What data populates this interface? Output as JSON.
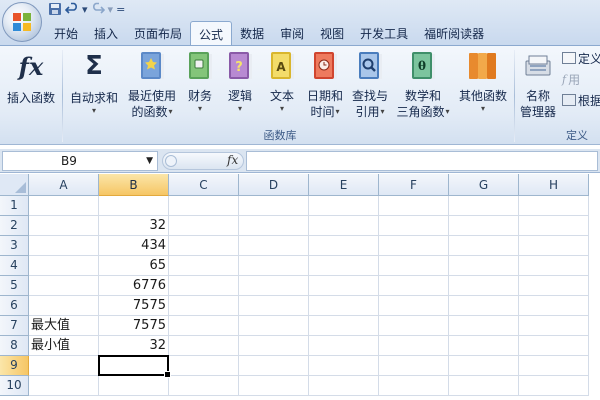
{
  "quick_access": {
    "dropdown_glyph": "▾",
    "separator": "="
  },
  "tabs": [
    "开始",
    "插入",
    "页面布局",
    "公式",
    "数据",
    "审阅",
    "视图",
    "开发工具",
    "福昕阅读器"
  ],
  "active_tab": "公式",
  "ribbon": {
    "insert_function": {
      "label": "插入函数",
      "icon_text": "fx"
    },
    "autosum": {
      "label": "自动求和",
      "icon_text": "Σ"
    },
    "recent": {
      "line1": "最近使用",
      "line2": "的函数"
    },
    "financial": {
      "label": "财务"
    },
    "logical": {
      "label": "逻辑"
    },
    "text_fn": {
      "label": "文本"
    },
    "datetime": {
      "line1": "日期和",
      "line2": "时间"
    },
    "lookup": {
      "line1": "查找与",
      "line2": "引用"
    },
    "math": {
      "line1": "数学和",
      "line2": "三角函数"
    },
    "more": {
      "label": "其他函数"
    },
    "group_label": "函数库",
    "name_manager": {
      "line1": "名称",
      "line2": "管理器"
    },
    "define_name": "定义",
    "use_in_formula": "用",
    "create_from_sel": "根据",
    "group_label_2": "定义",
    "dropdown_arrow": "▾"
  },
  "formula_bar": {
    "name_box": "B9",
    "fx_label": "fx",
    "dropdown_glyph": "▼",
    "formula": ""
  },
  "columns": [
    "A",
    "B",
    "C",
    "D",
    "E",
    "F",
    "G",
    "H"
  ],
  "selected_column": "B",
  "rows": [
    {
      "num": "1",
      "a": "",
      "b": ""
    },
    {
      "num": "2",
      "a": "",
      "b": "32"
    },
    {
      "num": "3",
      "a": "",
      "b": "434"
    },
    {
      "num": "4",
      "a": "",
      "b": "65"
    },
    {
      "num": "5",
      "a": "",
      "b": "6776"
    },
    {
      "num": "6",
      "a": "",
      "b": "7575"
    },
    {
      "num": "7",
      "a": "最大值",
      "b": "7575"
    },
    {
      "num": "8",
      "a": "最小值",
      "b": "32"
    },
    {
      "num": "9",
      "a": "",
      "b": ""
    },
    {
      "num": "10",
      "a": "",
      "b": ""
    }
  ],
  "selected_row": "9",
  "active_cell": "B9"
}
